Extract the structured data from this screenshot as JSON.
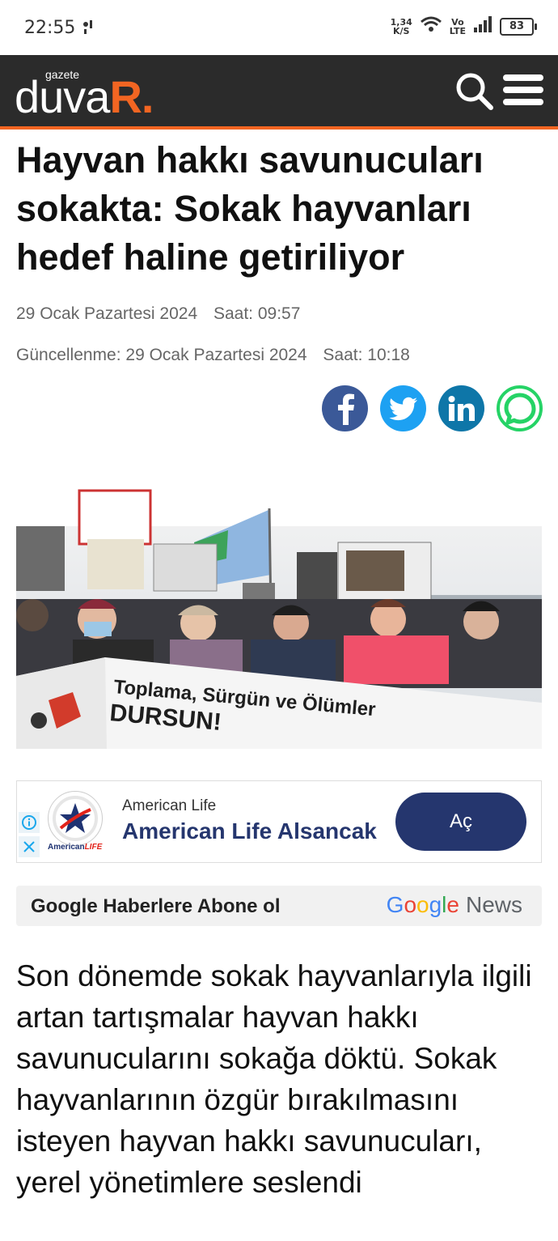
{
  "status_bar": {
    "time": "22:55",
    "speed": "1,34",
    "speed_unit": "K/S",
    "volte_top": "Vo",
    "volte_bottom": "LTE",
    "battery": "83"
  },
  "header": {
    "logo_small": "gazete",
    "logo_main": "duva",
    "logo_r": "R."
  },
  "article": {
    "title": "Hayvan hakkı savunucuları sokakta: Sokak hayvanları hedef haline getiriliyor",
    "date": "29 Ocak Pazartesi 2024",
    "time": "Saat: 09:57",
    "updated_date": "Güncellenme: 29 Ocak Pazartesi 2024",
    "updated_time": "Saat: 10:18",
    "lead": "Son dönemde sokak hayvanlarıyla ilgili artan tartışmalar hayvan hakkı savunucularını sokağa döktü. Sokak hayvanlarının özgür bırakılmasını isteyen hayvan hakkı savunucuları, yerel yönetimlere seslendi"
  },
  "photo": {
    "banner_line1": "Toplama, Sürgün ve Ölümler",
    "banner_line2": "DURSUN!"
  },
  "ad": {
    "brand": "American Life",
    "headline": "American Life Alsancak",
    "cta": "Aç",
    "logo_name": "American",
    "logo_accent": "LIFE"
  },
  "gnews": {
    "text": "Google Haberlere Abone ol",
    "logo_g1": "G",
    "logo_o1": "o",
    "logo_o2": "o",
    "logo_g2": "g",
    "logo_l": "l",
    "logo_e": "e",
    "logo_news": "News"
  },
  "colors": {
    "accent": "#f26522",
    "header_bg": "#2b2b2b",
    "ad_button": "#25366e"
  }
}
